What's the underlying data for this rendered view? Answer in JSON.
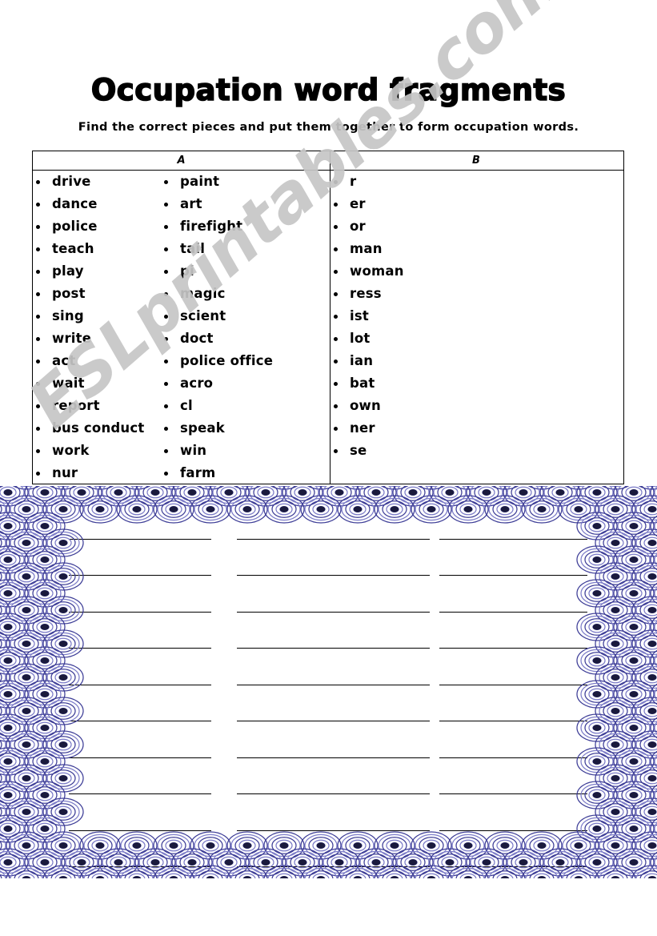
{
  "worksheet": {
    "title": "Occupation word fragments",
    "instruction": "Find the correct pieces and put them together to form occupation words.",
    "watermark": "ESLprintables.com"
  },
  "table": {
    "headers": {
      "a": "A",
      "b": "B"
    },
    "column_a_part1": [
      "drive",
      "dance",
      "police",
      "teach",
      "play",
      "post",
      "sing",
      "write",
      "act",
      "wait",
      "report",
      "bus conduct",
      "work",
      "nur"
    ],
    "column_a_part2": [
      "paint",
      "art",
      "firefight",
      "tail",
      "pi",
      "magic",
      "scient",
      "doct",
      "police office",
      "acro",
      "cl",
      "speak",
      "win",
      "farm"
    ],
    "column_b": [
      "r",
      "er",
      "or",
      "man",
      "woman",
      "ress",
      "ist",
      "lot",
      "ian",
      "bat",
      "own",
      "ner",
      "se"
    ]
  },
  "answer_area": {
    "line_count": 10,
    "columns_per_line": 3
  },
  "colors": {
    "border_ring": "#3c3c96",
    "border_ring_light": "#7c7cc8",
    "border_center": "#1a1a3c",
    "ink": "#000000",
    "watermark": "#c6c6c6",
    "page": "#ffffff"
  }
}
